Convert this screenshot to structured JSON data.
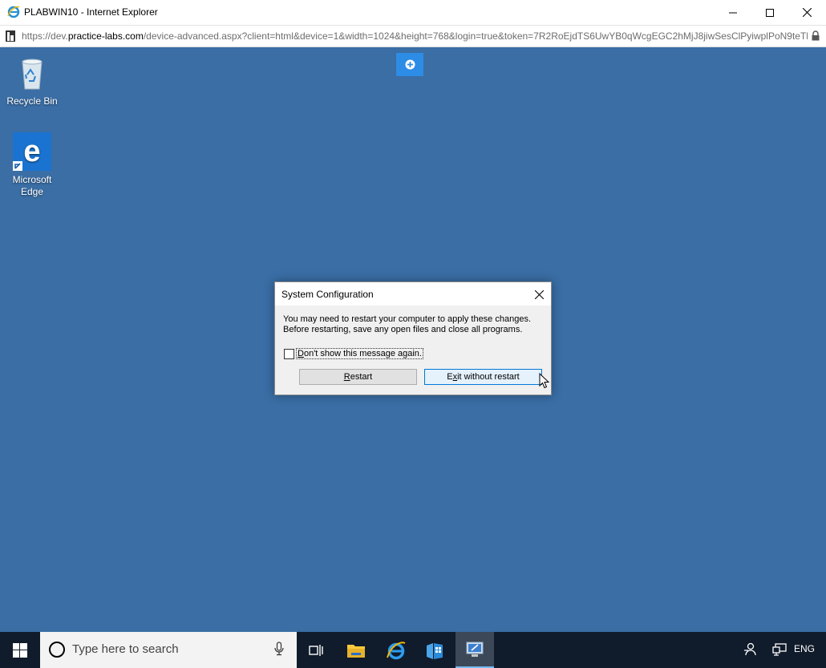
{
  "browser": {
    "title": "PLABWIN10 - Internet Explorer",
    "url_prefix": "https://dev.",
    "url_host": "practice-labs.com",
    "url_rest": "/device-advanced.aspx?client=html&device=1&width=1024&height=768&login=true&token=7R2RoEjdTS6UwYB0qWcgEGC2hMjJ8jiwSesClPyiwplPoN9teTl"
  },
  "desktop": {
    "icons": [
      {
        "label": "Recycle Bin",
        "icon": "recycle-bin-icon"
      },
      {
        "label": "Microsoft Edge",
        "icon": "edge-icon"
      }
    ],
    "background_color": "#3a6ea5"
  },
  "dialog": {
    "title": "System Configuration",
    "message_line1": "You may need to restart your computer to apply these changes.",
    "message_line2": "Before restarting, save any open files and close all programs.",
    "checkbox_label": "Don't show this message again.",
    "checkbox_checked": false,
    "restart_label": "Restart",
    "exit_label": "Exit without restart"
  },
  "taskbar": {
    "search_placeholder": "Type here to search",
    "language": "ENG",
    "apps": [
      "task-view-icon",
      "file-explorer-icon",
      "internet-explorer-icon",
      "store-icon",
      "msconfig-icon"
    ],
    "active_app": "msconfig-icon"
  }
}
